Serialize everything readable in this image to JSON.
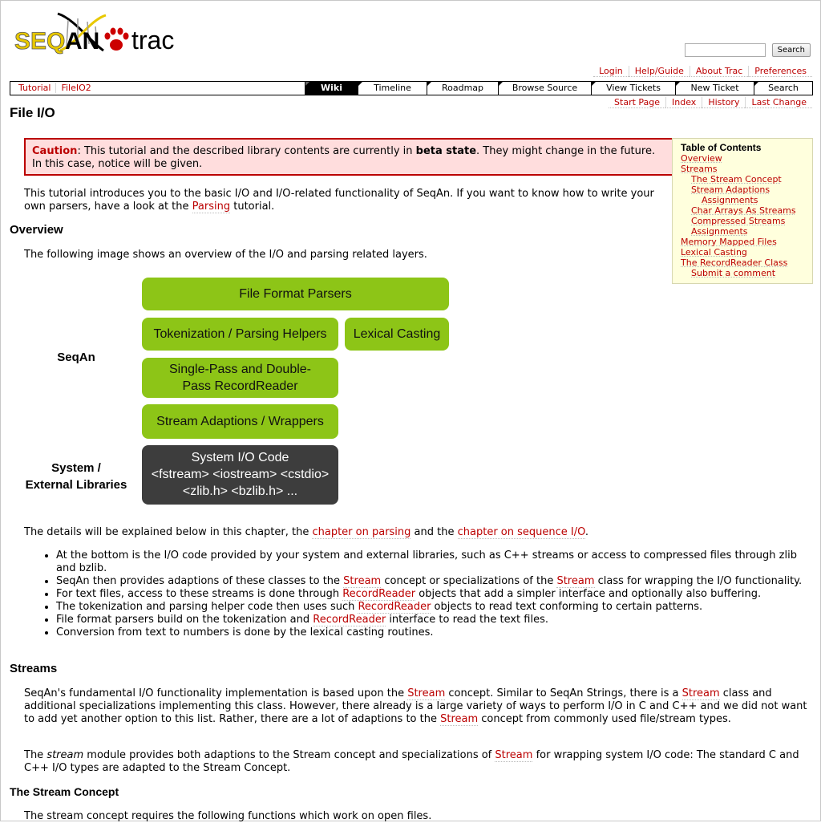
{
  "logo": {
    "text_seq": "SEQ",
    "text_an": "AN",
    "text_trac": "trac"
  },
  "search": {
    "placeholder": "",
    "button": "Search"
  },
  "metanav": [
    "Login",
    "Help/Guide",
    "About Trac",
    "Preferences"
  ],
  "breadcrumb": [
    "Tutorial",
    "FileIO2"
  ],
  "mainnav": [
    "Wiki",
    "Timeline",
    "Roadmap",
    "Browse Source",
    "View Tickets",
    "New Ticket",
    "Search"
  ],
  "ctxtnav": [
    "Start Page",
    "Index",
    "History",
    "Last Change"
  ],
  "page_title": "File I/O",
  "caution": {
    "label": "Caution",
    "before": ": This tutorial and the described library contents are currently in ",
    "bold": "beta state",
    "after": ". They might change in the future. In this case, notice will be given."
  },
  "toc": {
    "title": "Table of Contents",
    "items": [
      "Overview",
      "Streams",
      "The Stream Concept",
      "Stream Adaptions",
      "Assignments",
      "Char Arrays As Streams",
      "Compressed Streams",
      "Assignments",
      "Memory Mapped Files",
      "Lexical Casting",
      "The RecordReader Class",
      "Submit a comment"
    ]
  },
  "intro": {
    "before": "This tutorial introduces you to the basic I/O and I/O-related functionality of SeqAn. If you want to know how to write your own parsers, have a look at the ",
    "link": "Parsing",
    "after": " tutorial."
  },
  "overview": {
    "heading": "Overview",
    "text": "The following image shows an overview of the I/O and parsing related layers."
  },
  "diagram": {
    "boxes": [
      "File Format Parsers",
      "Tokenization / Parsing Helpers",
      "Lexical Casting",
      "Single-Pass and Double-Pass RecordReader",
      "Stream Adaptions / Wrappers"
    ],
    "system_box": [
      "System I/O Code",
      "<fstream> <iostream> <cstdio>",
      "<zlib.h> <bzlib.h> ..."
    ],
    "label_seqan": "SeqAn",
    "label_system": [
      "System /",
      "External Libraries"
    ]
  },
  "details": {
    "before": "The details will be explained below in this chapter, the ",
    "link1": "chapter on parsing",
    "mid": " and the ",
    "link2": "chapter on sequence I/O",
    "after": "."
  },
  "bullets": {
    "b1": "At the bottom is the I/O code provided by your system and external libraries, such as C++ streams or access to compressed files through zlib and bzlib.",
    "b2_a": "SeqAn then provides adaptions of these classes to the ",
    "b2_l1": "Stream",
    "b2_b": " concept or specializations of the ",
    "b2_l2": "Stream",
    "b2_c": " class for wrapping the I/O functionality.",
    "b3_a": "For text files, access to these streams is done through ",
    "b3_l": "RecordReader",
    "b3_b": " objects that add a simpler interface and optionally also buffering.",
    "b4_a": "The tokenization and parsing helper code then uses such ",
    "b4_l": "RecordReader",
    "b4_b": " objects to read text conforming to certain patterns.",
    "b5_a": "File format parsers build on the tokenization and ",
    "b5_l": "RecordReader",
    "b5_b": " interface to read the text files.",
    "b6": "Conversion from text to numbers is done by the lexical casting routines."
  },
  "streams": {
    "heading": "Streams",
    "p1_a": "SeqAn's fundamental I/O functionality implementation is based upon the ",
    "p1_l1": "Stream",
    "p1_b": " concept. Similar to SeqAn Strings, there is a ",
    "p1_l2": "Stream",
    "p1_c": " class and additional specializations implementing this class. However, there already is a large variety of ways to perform I/O in C and C++ and we did not want to add yet another option to this list. Rather, there are a lot of adaptions to the ",
    "p1_l3": "Stream",
    "p1_d": " concept from commonly used file/stream types.",
    "p2_a": "The ",
    "p2_em": "stream",
    "p2_b": " module provides both adaptions to the Stream concept and specializations of ",
    "p2_l": "Stream",
    "p2_c": " for wrapping system I/O code: The standard C and C++ I/O types are adapted to the Stream Concept."
  },
  "stream_concept": {
    "heading": "The Stream Concept",
    "text": "The stream concept requires the following functions which work on open files."
  }
}
